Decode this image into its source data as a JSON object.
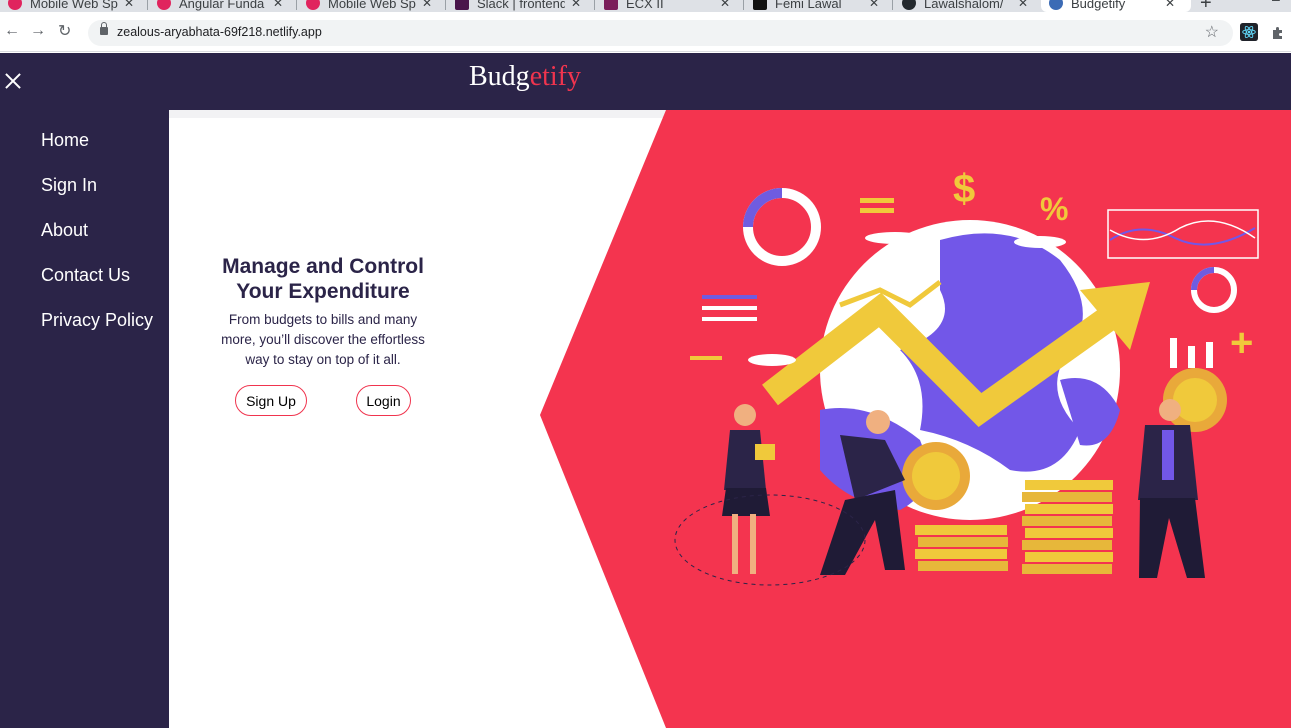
{
  "browser": {
    "tabs": [
      {
        "label": "Mobile Web Sp",
        "icon": "pink-circle-icon",
        "color": "#e0245e"
      },
      {
        "label": "Angular Funda",
        "icon": "pink-circle-icon",
        "color": "#e0245e"
      },
      {
        "label": "Mobile Web Sp",
        "icon": "pink-circle-icon",
        "color": "#e0245e"
      },
      {
        "label": "Slack | frontend",
        "icon": "slack-icon",
        "color": "#4a154b"
      },
      {
        "label": "ECX II",
        "icon": "ecx-icon",
        "color": "#7b1e5a"
      },
      {
        "label": "Femi Lawal",
        "icon": "dark-square-icon",
        "color": "#111111"
      },
      {
        "label": "Lawalshalom/",
        "icon": "github-icon",
        "color": "#24292e"
      },
      {
        "label": "Budgetify",
        "icon": "netlify-icon",
        "color": "#3b6bb5",
        "active": true
      }
    ],
    "url": "zealous-aryabhata-69f218.netlify.app",
    "new_tab_symbol": "+",
    "minimize_symbol": "–"
  },
  "header": {
    "brand_part1": "Budg",
    "brand_part2": "etify",
    "accent_color": "#f0344e",
    "bg_color": "#2b2448"
  },
  "sidebar": {
    "items": [
      {
        "label": "Home"
      },
      {
        "label": "Sign In"
      },
      {
        "label": "About"
      },
      {
        "label": "Contact Us"
      },
      {
        "label": "Privacy Policy"
      }
    ]
  },
  "hero": {
    "title": "Manage and Control Your Expenditure",
    "subtitle": "From budgets to bills and many more, you’ll discover the effortless way to stay on top of it all.",
    "signup_label": "Sign Up",
    "login_label": "Login"
  },
  "illustration": {
    "dollar_symbol": "$",
    "percent_symbol": "%",
    "plus_symbol": "+"
  }
}
